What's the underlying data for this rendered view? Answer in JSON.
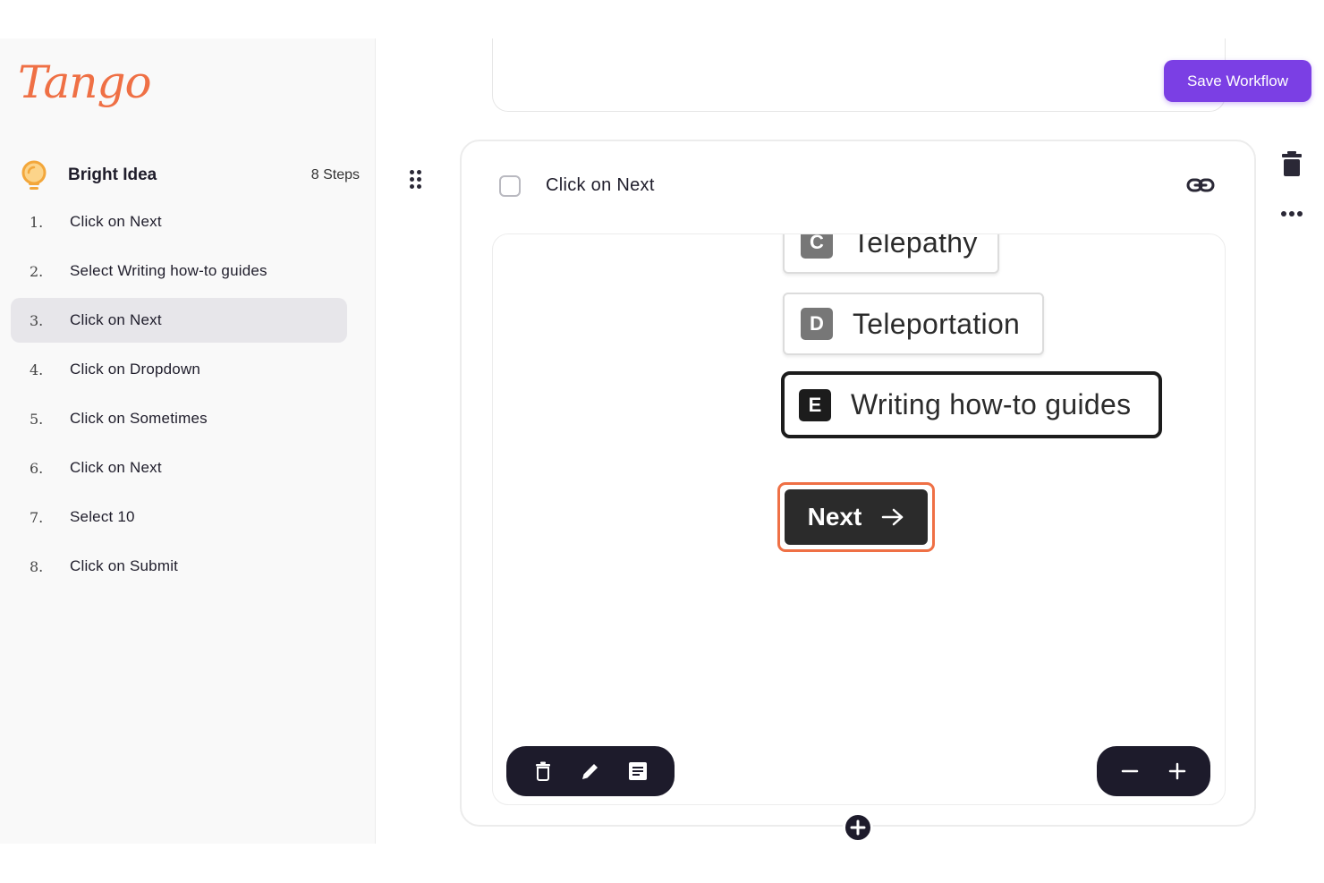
{
  "app": {
    "logo_text": "Tango"
  },
  "workflow": {
    "title": "Bright Idea",
    "step_count": "8 Steps"
  },
  "steps": [
    {
      "num": "1.",
      "label": "Click on Next"
    },
    {
      "num": "2.",
      "label": "Select Writing how-to guides"
    },
    {
      "num": "3.",
      "label": "Click on Next"
    },
    {
      "num": "4.",
      "label": "Click on Dropdown"
    },
    {
      "num": "5.",
      "label": "Click on Sometimes"
    },
    {
      "num": "6.",
      "label": "Click on Next"
    },
    {
      "num": "7.",
      "label": "Select 10"
    },
    {
      "num": "8.",
      "label": "Click on Submit"
    }
  ],
  "active_step": 3,
  "toolbar": {
    "save_label": "Save Workflow"
  },
  "card": {
    "title": "Click on Next"
  },
  "screenshot": {
    "options": [
      {
        "letter": "C",
        "text": "Telepathy"
      },
      {
        "letter": "D",
        "text": "Teleportation"
      },
      {
        "letter": "E",
        "text": "Writing how-to guides"
      }
    ],
    "next_label": "Next"
  },
  "colors": {
    "accent": "#7b3fe4",
    "brand": "#ef7045",
    "dark": "#1d1b2b"
  },
  "icons": {
    "bulb": "lightbulb-icon",
    "drag": "drag-handle-icon",
    "link": "link-icon",
    "trash": "trash-icon",
    "more": "more-horizontal-icon",
    "edit": "pencil-icon",
    "notes": "notes-icon",
    "zoom_out": "minus-icon",
    "zoom_in": "plus-icon",
    "add": "add-step-icon"
  }
}
